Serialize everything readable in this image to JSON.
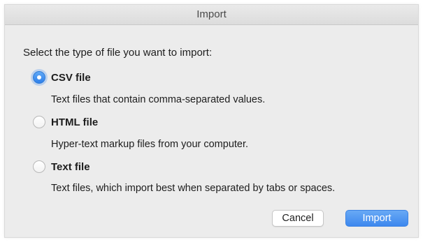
{
  "window": {
    "title": "Import"
  },
  "prompt": "Select the type of file you want to import:",
  "options": [
    {
      "label": "CSV file",
      "description": "Text files that contain comma-separated values.",
      "selected": true
    },
    {
      "label": "HTML file",
      "description": "Hyper-text markup files from your computer.",
      "selected": false
    },
    {
      "label": "Text file",
      "description": "Text files, which import best when separated by tabs or spaces.",
      "selected": false
    }
  ],
  "buttons": {
    "cancel": "Cancel",
    "import": "Import"
  },
  "colors": {
    "accent": "#3d88ee",
    "background": "#ececec"
  }
}
